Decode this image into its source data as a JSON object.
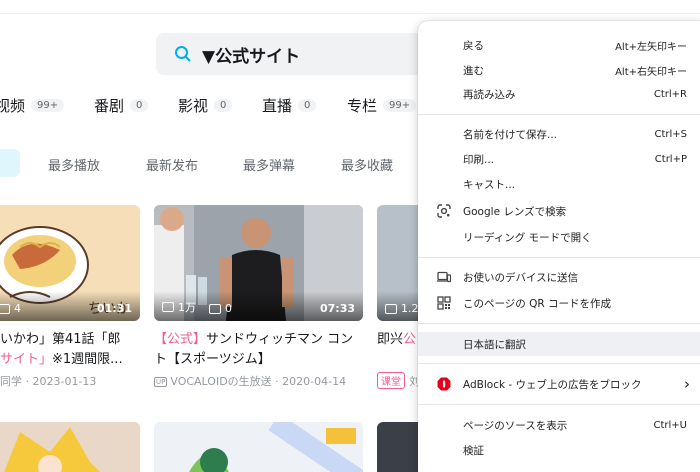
{
  "search": {
    "query": "▼公式サイト"
  },
  "category_tabs": [
    {
      "label": "视频",
      "count": "99+"
    },
    {
      "label": "番剧",
      "count": "0"
    },
    {
      "label": "影视",
      "count": "0"
    },
    {
      "label": "直播",
      "count": "0"
    },
    {
      "label": "专栏",
      "count": "99+"
    }
  ],
  "sort_options": [
    "最多播放",
    "最新发布",
    "最多弹幕",
    "最多收藏"
  ],
  "videos": [
    {
      "danmaku": "4",
      "duration": "01:31",
      "title_line1_pre": "いかわ」第41話「郎",
      "title_line2_hl": "サイト」",
      "title_line2_post": "※1週間限...",
      "meta": "同学 · 2023-01-13"
    },
    {
      "views": "1万",
      "danmaku": "0",
      "duration": "07:33",
      "title_hl": "【公式】",
      "title_line1_post": "サンドウィッチマン コン",
      "title_line2": "ト【スポーツジム】",
      "uploader": "VOCALOIDの生放送",
      "date": "2020-04-14",
      "up_badge": "UP"
    },
    {
      "views": "1.2",
      "title_pre": "即兴",
      "title_hl": "公",
      "tag": "课堂",
      "meta": "刘"
    }
  ],
  "context_menu": {
    "groups": [
      [
        {
          "label": "戻る",
          "shortcut": "Alt+左矢印キー"
        },
        {
          "label": "進む",
          "shortcut": "Alt+右矢印キー"
        },
        {
          "label": "再読み込み",
          "shortcut": "Ctrl+R"
        }
      ],
      [
        {
          "label": "名前を付けて保存...",
          "shortcut": "Ctrl+S"
        },
        {
          "label": "印刷...",
          "shortcut": "Ctrl+P"
        },
        {
          "label": "キャスト..."
        },
        {
          "label": "Google レンズで検索",
          "icon": "google-lens-icon"
        },
        {
          "label": "リーディング モードで開く"
        }
      ],
      [
        {
          "label": "お使いのデバイスに送信",
          "icon": "devices-icon"
        },
        {
          "label": "このページの QR コードを作成",
          "icon": "qr-code-icon"
        }
      ],
      [
        {
          "label": "日本語に翻訳"
        }
      ],
      [
        {
          "label": "AdBlock - ウェブ上の広告をブロック",
          "icon": "adblock-icon",
          "submenu_arrow": "›"
        }
      ],
      [
        {
          "label": "ページのソースを表示",
          "shortcut": "Ctrl+U"
        },
        {
          "label": "検証"
        }
      ]
    ]
  },
  "colors": {
    "accent": "#00aeec",
    "highlight": "#f25d8e",
    "adblock": "#e3001b",
    "menu_hover": "#eef0f3"
  }
}
